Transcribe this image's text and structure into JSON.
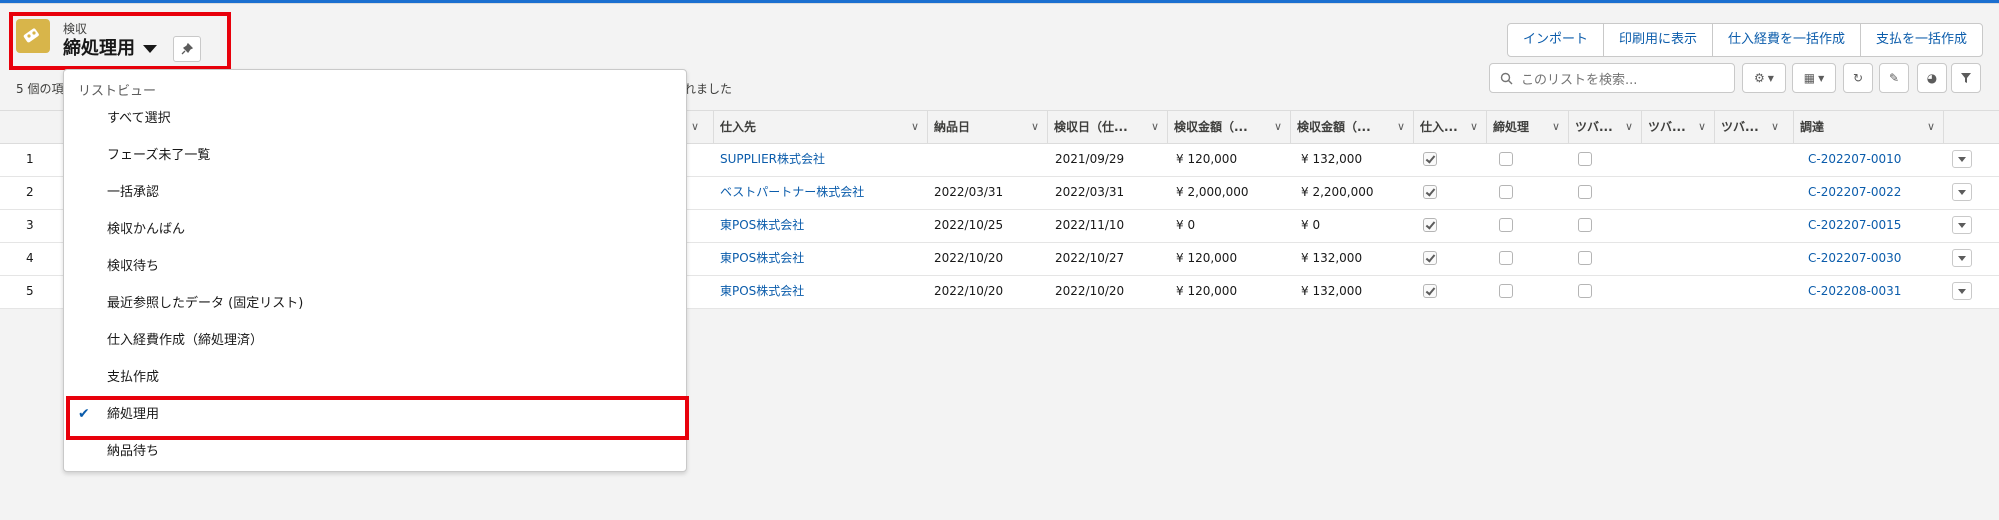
{
  "header": {
    "object_label": "検収",
    "list_name": "締処理用"
  },
  "status": {
    "count_prefix": "5 個の項",
    "count_suffix": "れました"
  },
  "actions": [
    "インポート",
    "印刷用に表示",
    "仕入経費を一括作成",
    "支払を一括作成"
  ],
  "search": {
    "placeholder": "このリストを検索..."
  },
  "dropdown": {
    "heading": "リストビュー",
    "items": [
      "すべて選択",
      "フェーズ未了一覧",
      "一括承認",
      "検収かんばん",
      "検収待ち",
      "最近参照したデータ (固定リスト)",
      "仕入経費作成（締処理済）",
      "支払作成",
      "締処理用",
      "納品待ち"
    ],
    "selected_index": 8
  },
  "table": {
    "columns": [
      "仕入先",
      "納品日",
      "検収日（仕...",
      "検収金額（...",
      "検収金額（...",
      "仕入...",
      "締処理",
      "ツバ...",
      "ツバ...",
      "ツバ...",
      "調達"
    ],
    "rows": [
      {
        "num": "1",
        "supplier": "SUPPLIER株式会社",
        "delivery": "",
        "inspection": "2021/09/29",
        "amount1": "¥ 120,000",
        "amount2": "¥ 132,000",
        "cb1": true,
        "cb2": false,
        "cb3": false,
        "procure": "C-202207-0010"
      },
      {
        "num": "2",
        "supplier": "ベストパートナー株式会社",
        "delivery": "2022/03/31",
        "inspection": "2022/03/31",
        "amount1": "¥ 2,000,000",
        "amount2": "¥ 2,200,000",
        "cb1": true,
        "cb2": false,
        "cb3": false,
        "procure": "C-202207-0022"
      },
      {
        "num": "3",
        "supplier": "東POS株式会社",
        "delivery": "2022/10/25",
        "inspection": "2022/11/10",
        "amount1": "¥ 0",
        "amount2": "¥ 0",
        "cb1": true,
        "cb2": false,
        "cb3": false,
        "procure": "C-202207-0015"
      },
      {
        "num": "4",
        "supplier": "東POS株式会社",
        "delivery": "2022/10/20",
        "inspection": "2022/10/27",
        "amount1": "¥ 120,000",
        "amount2": "¥ 132,000",
        "cb1": true,
        "cb2": false,
        "cb3": false,
        "procure": "C-202207-0030"
      },
      {
        "num": "5",
        "supplier": "東POS株式会社",
        "delivery": "2022/10/20",
        "inspection": "2022/10/20",
        "amount1": "¥ 120,000",
        "amount2": "¥ 132,000",
        "cb1": true,
        "cb2": false,
        "cb3": false,
        "procure": "C-202208-0031"
      }
    ]
  },
  "colors": {
    "accent": "#0b5cab",
    "highlight": "#e8000b",
    "icon_bg": "#d8b54a"
  }
}
